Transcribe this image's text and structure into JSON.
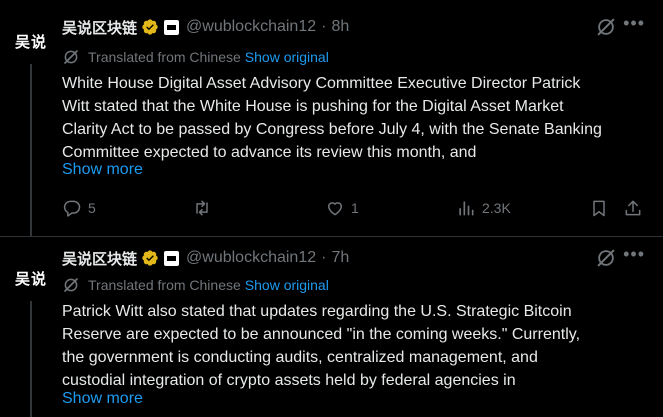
{
  "tweets": [
    {
      "avatar_text": "吴说",
      "name": "吴说区块链",
      "handle": "@wublockchain12",
      "time": "8h",
      "translated_label": "Translated from Chinese",
      "show_original": "Show original",
      "lines": [
        "White House Digital Asset Advisory Committee Executive Director Patrick",
        "Witt stated that the White House is pushing for the Digital Asset Market",
        "Clarity Act to be passed by Congress before July 4, with the Senate Banking",
        "Committee expected to advance its review this month, and"
      ],
      "show_more": "Show more",
      "replies": "5",
      "reposts": "",
      "likes": "1",
      "views": "2.3K"
    },
    {
      "avatar_text": "吴说",
      "name": "吴说区块链",
      "handle": "@wublockchain12",
      "time": "7h",
      "translated_label": "Translated from Chinese",
      "show_original": "Show original",
      "lines": [
        "Patrick Witt also stated that updates regarding the U.S. Strategic Bitcoin",
        "Reserve are expected to be announced \"in the coming weeks.\" Currently,",
        "the government is conducting audits, centralized management, and",
        "custodial integration of crypto assets held by federal agencies in"
      ],
      "show_more": "Show more"
    }
  ],
  "separator": "·",
  "icons": {
    "verified": "verified-badge-icon",
    "affiliate": "affiliate-badge-icon",
    "grok": "grok-icon",
    "more": "more-icon",
    "translate": "translate-icon",
    "reply": "reply-icon",
    "repost": "repost-icon",
    "like": "like-icon",
    "views": "views-icon",
    "bookmark": "bookmark-icon",
    "share": "share-icon"
  },
  "colors": {
    "background": "#000000",
    "text": "#e7e9ea",
    "muted": "#71767b",
    "link": "#1d9bf0",
    "verified_gold": "#e2b719",
    "divider": "#2f3336"
  }
}
